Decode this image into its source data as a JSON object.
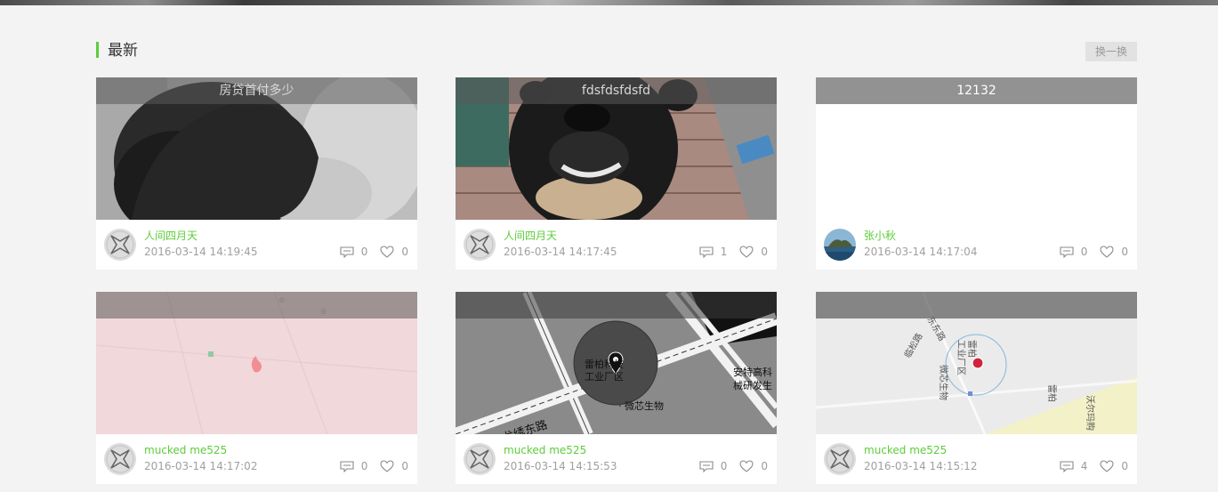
{
  "section": {
    "title": "最新",
    "swap_label": "换一换"
  },
  "colors": {
    "accent": "#5ccd3a",
    "background": "#f3f3f3"
  },
  "cards": [
    {
      "title": "房贷首付多少",
      "image": "photo-woman-hair",
      "author": "人间四月天",
      "avatar": "default-avatar-icon",
      "time": "2016-03-14 14:19:45",
      "comments": "0",
      "likes": "0"
    },
    {
      "title": "fdsfdsfdsfd",
      "image": "photo-dog",
      "author": "人间四月天",
      "avatar": "default-avatar-icon",
      "time": "2016-03-14 14:17:45",
      "comments": "1",
      "likes": "0"
    },
    {
      "title": "12132",
      "image": "blank",
      "author": "张小秋",
      "avatar": "landscape-avatar",
      "time": "2016-03-14 14:17:04",
      "comments": "0",
      "likes": "0"
    },
    {
      "title": "",
      "image": "map-pink",
      "author": "mucked me525",
      "avatar": "default-avatar-icon",
      "time": "2016-03-14 14:17:02",
      "comments": "0",
      "likes": "0"
    },
    {
      "title": "",
      "image": "map-zoomed",
      "author": "mucked me525",
      "avatar": "default-avatar-icon",
      "time": "2016-03-14 14:15:53",
      "comments": "0",
      "likes": "0"
    },
    {
      "title": "",
      "image": "map-grey",
      "author": "mucked me525",
      "avatar": "default-avatar-icon",
      "time": "2016-03-14 14:15:12",
      "comments": "4",
      "likes": "0"
    }
  ],
  "map_labels": {
    "zoomed_district": "雷柏科技\n工业厂区",
    "zoomed_company": "安特高科\n械研发生",
    "zoomed_bio": "微芯生物",
    "zoomed_road": "龙绣东路",
    "grey_district": "雷柏\n工业厂区",
    "grey_road1": "东东路",
    "grey_road2": "临松路",
    "grey_bio": "微芯生物",
    "grey_leibo": "雷柏",
    "grey_wal": "沃尔玛购"
  }
}
